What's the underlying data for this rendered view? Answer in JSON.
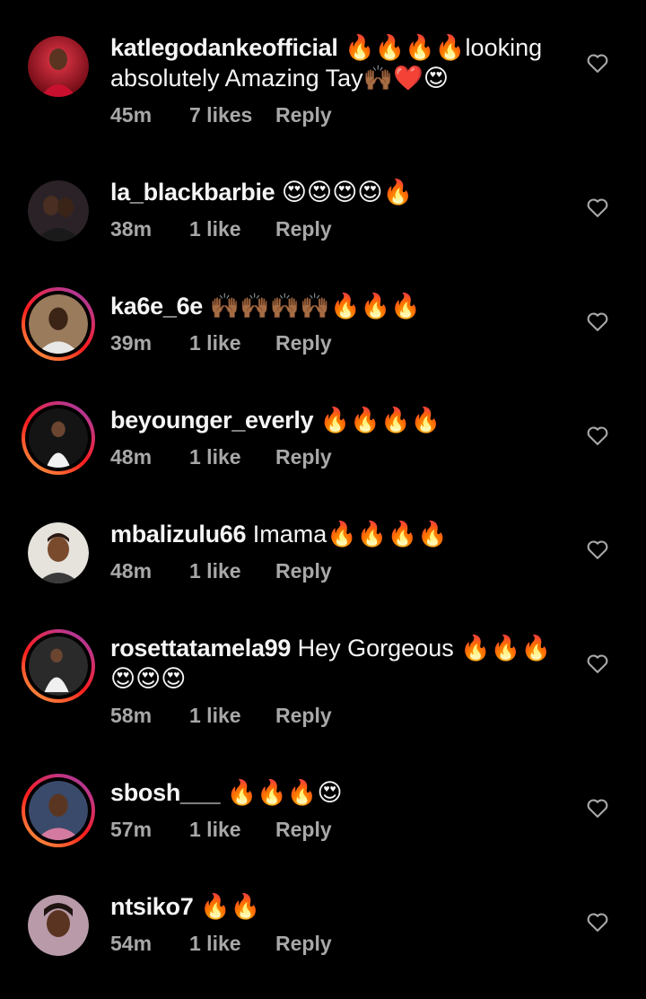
{
  "icons": {
    "like": "heart-outline-icon",
    "fire": "🔥",
    "heart_eyes": "😍",
    "praise_hands": "🙌🏾",
    "red_heart": "❤️"
  },
  "colors": {
    "background": "#000000",
    "text": "#f5f5f5",
    "meta": "#a8a8a8",
    "story_ring": [
      "#fcb045",
      "#fd1d1d",
      "#c13584",
      "#833ab4"
    ]
  },
  "comments": [
    {
      "username": "katlegodankeofficial",
      "text": " 🔥🔥🔥🔥looking absolutely Amazing Tay🙌🏾❤️😍",
      "time": "45m",
      "likes": "7 likes",
      "reply": "Reply"
    },
    {
      "username": "la_blackbarbie",
      "text": " 😍😍😍😍🔥",
      "time": "38m",
      "likes": "1 like",
      "reply": "Reply"
    },
    {
      "username": "ka6e_6e",
      "text": " 🙌🏾🙌🏾🙌🏾🙌🏾🔥🔥🔥",
      "time": "39m",
      "likes": "1 like",
      "reply": "Reply"
    },
    {
      "username": "beyounger_everly",
      "text": " 🔥🔥🔥🔥",
      "time": "48m",
      "likes": "1 like",
      "reply": "Reply"
    },
    {
      "username": "mbalizulu66",
      "text": " Imama🔥🔥🔥🔥",
      "time": "48m",
      "likes": "1 like",
      "reply": "Reply"
    },
    {
      "username": "rosettatamela99",
      "text": " Hey Gorgeous 🔥🔥🔥😍😍😍",
      "time": "58m",
      "likes": "1 like",
      "reply": "Reply"
    },
    {
      "username": "sbosh___",
      "text": " 🔥🔥🔥😍",
      "time": "57m",
      "likes": "1 like",
      "reply": "Reply"
    },
    {
      "username": "ntsiko7",
      "text": " 🔥🔥",
      "time": "54m",
      "likes": "1 like",
      "reply": "Reply"
    }
  ]
}
